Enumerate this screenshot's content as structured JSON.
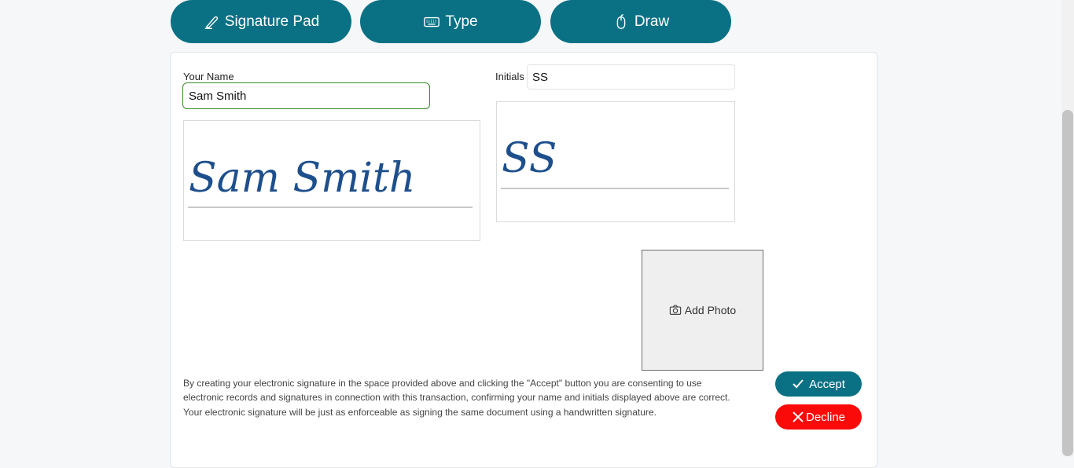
{
  "tabs": [
    {
      "label": "Signature Pad",
      "icon": "pen-icon"
    },
    {
      "label": "Type",
      "icon": "keyboard-icon"
    },
    {
      "label": "Draw",
      "icon": "mouse-icon"
    }
  ],
  "form": {
    "name_label": "Your Name",
    "name_value": "Sam Smith",
    "initials_label": "Initials",
    "initials_value": "SS"
  },
  "signature_preview": "Sam Smith",
  "initials_preview": "SS",
  "photo": {
    "label": "Add Photo",
    "icon": "camera-icon"
  },
  "consent_text": "By creating your electronic signature in the space provided above and clicking the \"Accept\" button you are consenting to use electronic records and signatures in connection with this transaction, confirming your name and initials displayed above are correct. Your electronic signature will be just as enforceable as signing the same document using a handwritten signature.",
  "actions": {
    "accept_label": "Accept",
    "decline_label": "Decline"
  },
  "colors": {
    "primary": "#0a7184",
    "danger": "#fb0a0a",
    "signature_ink": "#1d4f8c",
    "name_border": "#3a8a2a"
  }
}
